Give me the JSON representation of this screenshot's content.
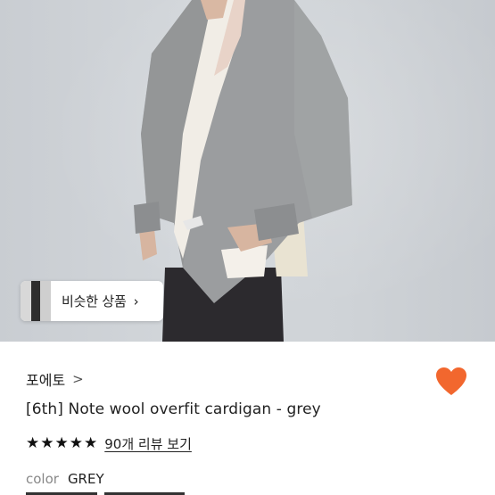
{
  "photo": {
    "alt_subject": "model wearing grey wool cardigan"
  },
  "similar_products": {
    "label": "비슷한 상품",
    "chevron": "chevron-right-icon"
  },
  "product": {
    "brand": "포에토",
    "brand_chevron": ">",
    "title": "[6th] Note wool overfit cardigan - grey",
    "rating_stars": 5,
    "reviews_label": "90개 리뷰 보기",
    "color_key": "color",
    "color_value": "GREY",
    "favorite": true
  },
  "colors": {
    "heart": "#f2672e",
    "star": "#111111",
    "cardigan": "#9a9c9e",
    "shirt": "#f1ede6",
    "pants": "#2c2a2e"
  }
}
